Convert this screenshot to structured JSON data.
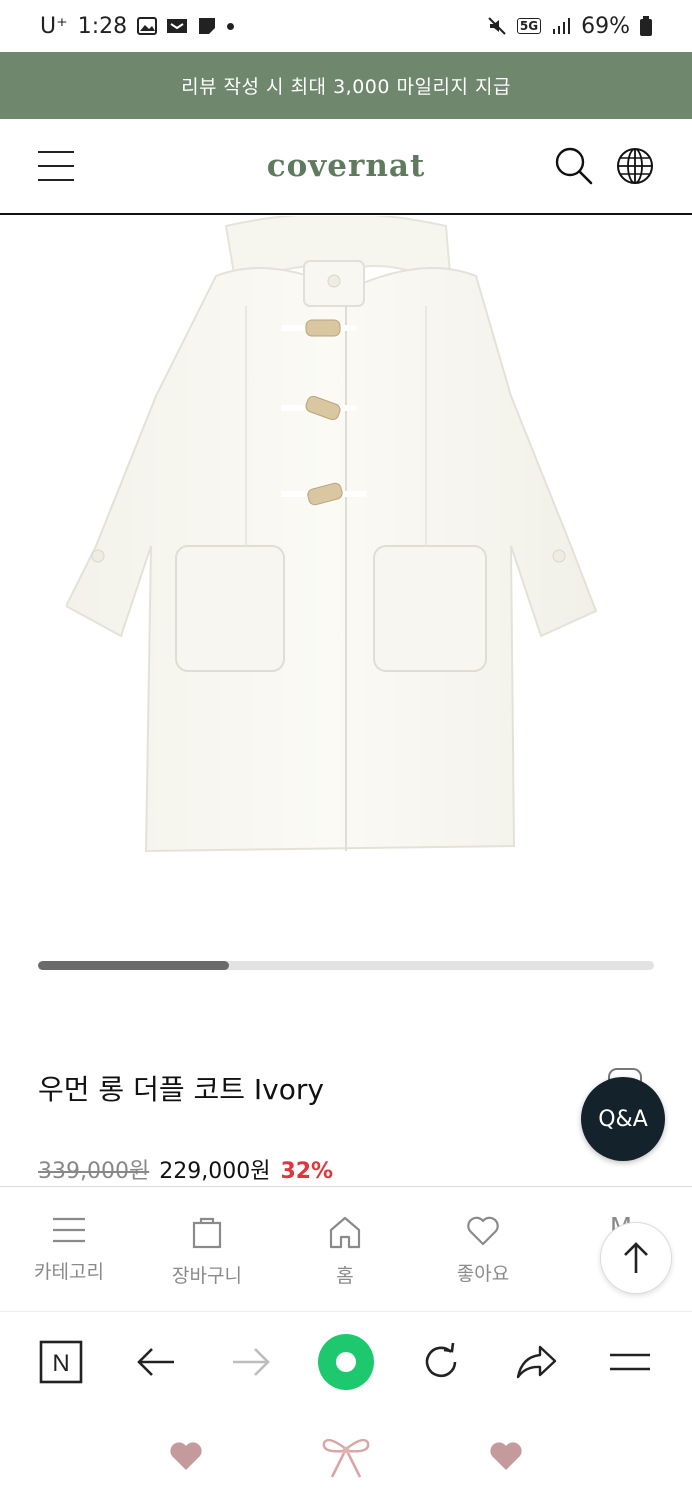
{
  "status_bar": {
    "carrier": "U⁺",
    "time": "1:28",
    "network": "5G",
    "battery": "69%"
  },
  "promo": {
    "text": "리뷰 작성 시 최대 3,000 마일리지 지급"
  },
  "header": {
    "logo": "covernat"
  },
  "carousel": {
    "progress_fraction": 0.31
  },
  "product": {
    "title": "우먼 롱 더플 코트 Ivory",
    "original_price": "339,000원",
    "sale_price": "229,000원",
    "discount": "32%"
  },
  "qna": {
    "label": "Q&A"
  },
  "site_nav": {
    "items": [
      {
        "label": "카테고리",
        "icon": "menu-lines-icon"
      },
      {
        "label": "장바구니",
        "icon": "shopping-bag-icon"
      },
      {
        "label": "홈",
        "icon": "home-icon"
      },
      {
        "label": "좋아요",
        "icon": "heart-icon"
      },
      {
        "label": "M",
        "icon": "my-page-icon"
      }
    ]
  },
  "browser_toolbar": {
    "n_label": "N"
  },
  "colors": {
    "promo_bg": "#6f876d",
    "logo": "#5f7a5e",
    "discount": "#e0353a",
    "qna_bg": "#14222b",
    "toolbar_green": "#1ec86e",
    "decor_pink": "#c49a9c"
  }
}
